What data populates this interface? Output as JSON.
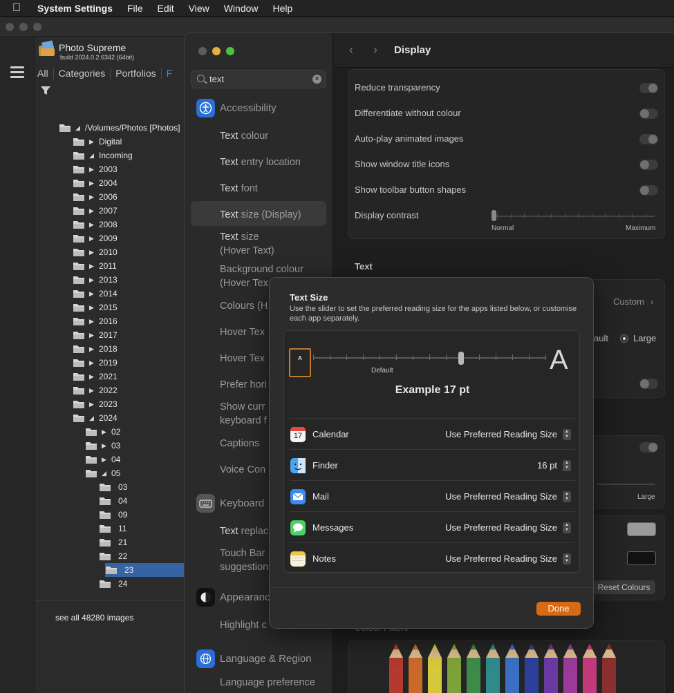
{
  "menubar": {
    "app": "System Settings",
    "items": [
      "File",
      "Edit",
      "View",
      "Window",
      "Help"
    ]
  },
  "photo_supreme": {
    "title": "Photo Supreme",
    "build": "build 2024.0.2.6342 (64bit)",
    "tabs": [
      "All",
      "Categories",
      "Portfolios",
      "F"
    ],
    "tree": [
      {
        "label": "/Volumes/Photos  [Photos]",
        "depth": 0,
        "arrow": "open"
      },
      {
        "label": "Digital",
        "depth": 1,
        "arrow": "closed"
      },
      {
        "label": "Incoming",
        "depth": 1,
        "arrow": "open"
      },
      {
        "label": "2003",
        "depth": 2,
        "arrow": "closed"
      },
      {
        "label": "2004",
        "depth": 2,
        "arrow": "closed"
      },
      {
        "label": "2006",
        "depth": 2,
        "arrow": "closed"
      },
      {
        "label": "2007",
        "depth": 2,
        "arrow": "closed"
      },
      {
        "label": "2008",
        "depth": 2,
        "arrow": "closed"
      },
      {
        "label": "2009",
        "depth": 2,
        "arrow": "closed"
      },
      {
        "label": "2010",
        "depth": 2,
        "arrow": "closed"
      },
      {
        "label": "2011",
        "depth": 2,
        "arrow": "closed"
      },
      {
        "label": "2013",
        "depth": 2,
        "arrow": "closed"
      },
      {
        "label": "2014",
        "depth": 2,
        "arrow": "closed"
      },
      {
        "label": "2015",
        "depth": 2,
        "arrow": "closed"
      },
      {
        "label": "2016",
        "depth": 2,
        "arrow": "closed"
      },
      {
        "label": "2017",
        "depth": 2,
        "arrow": "closed"
      },
      {
        "label": "2018",
        "depth": 2,
        "arrow": "closed"
      },
      {
        "label": "2019",
        "depth": 2,
        "arrow": "closed"
      },
      {
        "label": "2021",
        "depth": 2,
        "arrow": "closed"
      },
      {
        "label": "2022",
        "depth": 2,
        "arrow": "closed"
      },
      {
        "label": "2023",
        "depth": 2,
        "arrow": "closed"
      },
      {
        "label": "2024",
        "depth": 2,
        "arrow": "open"
      },
      {
        "label": "02",
        "depth": 3,
        "arrow": "closed"
      },
      {
        "label": "03",
        "depth": 3,
        "arrow": "closed"
      },
      {
        "label": "04",
        "depth": 3,
        "arrow": "closed"
      },
      {
        "label": "05",
        "depth": 3,
        "arrow": "open"
      },
      {
        "label": "03",
        "depth": 4,
        "arrow": "none"
      },
      {
        "label": "04",
        "depth": 4,
        "arrow": "none"
      },
      {
        "label": "09",
        "depth": 4,
        "arrow": "none"
      },
      {
        "label": "11",
        "depth": 4,
        "arrow": "none"
      },
      {
        "label": "21",
        "depth": 4,
        "arrow": "none"
      },
      {
        "label": "22",
        "depth": 4,
        "arrow": "none"
      },
      {
        "label": "23",
        "depth": 4,
        "arrow": "none",
        "selected": true
      },
      {
        "label": "24",
        "depth": 4,
        "arrow": "none"
      }
    ],
    "see_all": "see all 48280 images"
  },
  "settings": {
    "search": {
      "value": "text"
    },
    "sidebar": {
      "accessibility": "Accessibility",
      "items": [
        {
          "pre": "Text",
          "post": " colour"
        },
        {
          "pre": "Text",
          "post": " entry location"
        },
        {
          "pre": "Text",
          "post": " font"
        },
        {
          "pre": "Text",
          "post": " size (Display)"
        },
        {
          "pre": "Text",
          "post": " size"
        },
        {
          "pre": "",
          "post": "(Hover Text)"
        },
        {
          "pre": "",
          "post": "Background colour"
        },
        {
          "pre": "",
          "post": "(Hover Tex"
        },
        {
          "pre": "",
          "post": "Colours (H"
        },
        {
          "pre": "",
          "post": "Hover Tex"
        },
        {
          "pre": "",
          "post": "Hover Tex"
        },
        {
          "pre": "",
          "post": "Prefer hori"
        },
        {
          "pre": "",
          "post": "Show curr"
        },
        {
          "pre": "",
          "post": "keyboard f"
        },
        {
          "pre": "",
          "post": "Captions"
        },
        {
          "pre": "",
          "post": "Voice Con"
        }
      ],
      "keyboard": "Keyboard",
      "keyboard_items": [
        {
          "pre": "Text",
          "post": " replac"
        },
        {
          "pre": "",
          "post": "Touch Bar"
        },
        {
          "pre": "",
          "post": "suggestion"
        }
      ],
      "appearance": "Appearanc",
      "appearance_items": [
        {
          "pre": "",
          "post": "Highlight c"
        }
      ],
      "language": "Language & Region",
      "language_items": [
        {
          "pre": "",
          "post": "Language preference"
        }
      ]
    },
    "header": {
      "title": "Display",
      "back": "‹",
      "forward": "›"
    },
    "display_rows": [
      {
        "label": "Reduce transparency",
        "on": true
      },
      {
        "label": "Differentiate without colour",
        "on": false
      },
      {
        "label": "Auto-play animated images",
        "on": true
      },
      {
        "label": "Show window title icons",
        "on": false
      },
      {
        "label": "Show toolbar button shapes",
        "on": false
      }
    ],
    "contrast": {
      "label": "Display contrast",
      "min": "Normal",
      "max": "Maximum"
    },
    "text_section": "Text",
    "custom": "Custom",
    "ault": "ault",
    "large_radio": "Large",
    "large_lbl": "Large",
    "reset_colours": "Reset Colours",
    "colour_filters": "Colour Filters"
  },
  "modal": {
    "title": "Text Size",
    "description": "Use the slider to set the preferred reading size for the apps listed below, or customise each app separately.",
    "small_a": "A",
    "big_a": "A",
    "default_label": "Default",
    "example": "Example 17 pt",
    "apps": [
      {
        "name": "Calendar",
        "value": "Use Preferred Reading Size",
        "icon": "calendar-icon"
      },
      {
        "name": "Finder",
        "value": "16 pt",
        "icon": "finder-icon"
      },
      {
        "name": "Mail",
        "value": "Use Preferred Reading Size",
        "icon": "mail-icon"
      },
      {
        "name": "Messages",
        "value": "Use Preferred Reading Size",
        "icon": "messages-icon"
      },
      {
        "name": "Notes",
        "value": "Use Preferred Reading Size",
        "icon": "notes-icon"
      }
    ],
    "calendar_day": "17",
    "done": "Done"
  },
  "colors": {
    "accent": "#d96a14",
    "selection": "#3464a3",
    "link": "#3f8ed6"
  }
}
